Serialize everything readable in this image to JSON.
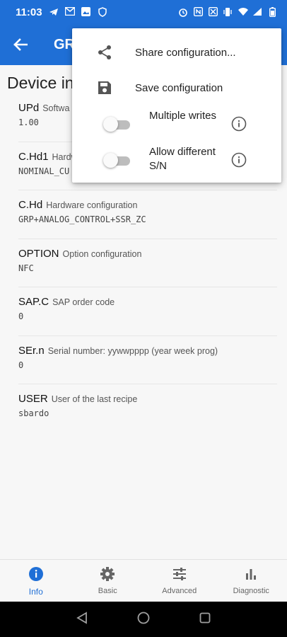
{
  "status_bar": {
    "time": "11:03",
    "icons_left": [
      "telegram-icon",
      "gmail-icon",
      "gallery-icon",
      "vpn-shield-icon"
    ],
    "icons_right": [
      "alarm-icon",
      "nfc-icon",
      "no-sim-icon",
      "vibrate-icon",
      "wifi-icon",
      "signal-icon",
      "battery-icon"
    ]
  },
  "app_bar": {
    "title": "GR",
    "back_icon": "arrow-left-icon"
  },
  "section": {
    "title": "Device in"
  },
  "params": [
    {
      "code": "UPd",
      "desc": "Softwa",
      "value": "1.00"
    },
    {
      "code": "C.Hd1",
      "desc": "Hardw",
      "value": "NOMINAL_CU"
    },
    {
      "code": "C.Hd",
      "desc": "Hardware configuration",
      "value": "GRP+ANALOG_CONTROL+SSR_ZC"
    },
    {
      "code": "OPTION",
      "desc": "Option configuration",
      "value": "NFC"
    },
    {
      "code": "SAP.C",
      "desc": "SAP order code",
      "value": "0"
    },
    {
      "code": "SEr.n",
      "desc": "Serial number: yywwpppp (year week prog)",
      "value": "0"
    },
    {
      "code": "USER",
      "desc": "User of the last recipe",
      "value": "sbardo"
    }
  ],
  "menu": {
    "share_label": "Share configuration...",
    "share_icon": "share-icon",
    "save_label": "Save configuration",
    "save_icon": "save-icon",
    "toggles": [
      {
        "label": "Multiple writes",
        "checked": false
      },
      {
        "label": "Allow different S/N",
        "checked": false
      }
    ],
    "info_icon": "info-outline-icon"
  },
  "bottom_nav": {
    "items": [
      {
        "label": "Info",
        "icon": "info-icon",
        "active": true
      },
      {
        "label": "Basic",
        "icon": "gear-icon",
        "active": false
      },
      {
        "label": "Advanced",
        "icon": "tune-icon",
        "active": false
      },
      {
        "label": "Diagnostic",
        "icon": "bar-chart-icon",
        "active": false
      }
    ]
  },
  "colors": {
    "primary": "#1f6fd6",
    "background": "#f7f7f7",
    "menu_bg": "#ffffff"
  }
}
